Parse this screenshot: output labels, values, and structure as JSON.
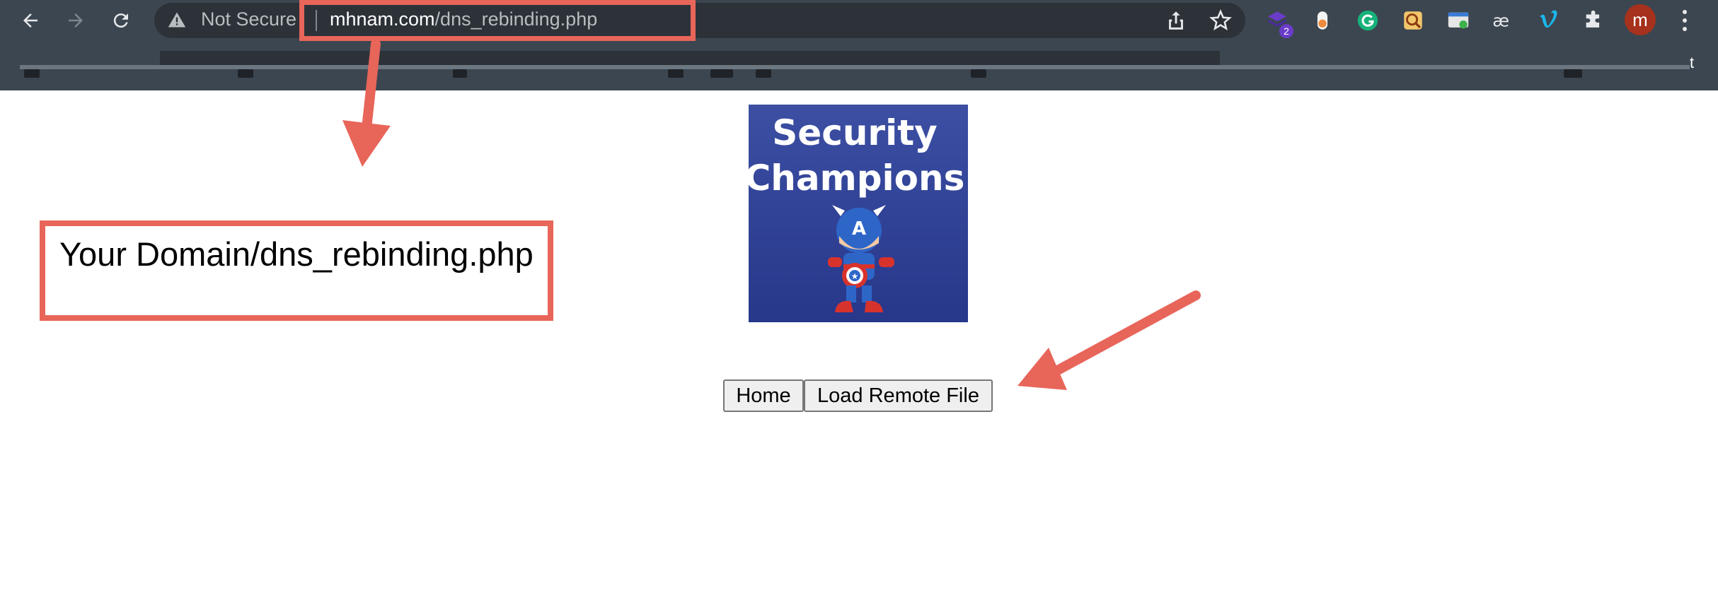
{
  "browser": {
    "address_bar": {
      "security_label": "Not Secure",
      "url_host": "mhnam.com",
      "url_path": "/dns_rebinding.php"
    },
    "extensions": [
      {
        "name": "stack-extension-icon",
        "badge": "2"
      },
      {
        "name": "toggle-extension-icon"
      },
      {
        "name": "grammarly-extension-icon"
      },
      {
        "name": "search-extension-icon"
      },
      {
        "name": "screenshot-extension-icon"
      },
      {
        "name": "ae-extension-icon"
      },
      {
        "name": "vimeo-extension-icon"
      },
      {
        "name": "puzzle-extensions-icon"
      }
    ],
    "profile_initial": "m",
    "bookmarks_trailing_char": "t"
  },
  "page": {
    "logo": {
      "line1": "Security",
      "line2": "Champions"
    },
    "buttons": {
      "home": "Home",
      "load_remote": "Load Remote File"
    }
  },
  "annotations": {
    "domain_note": "Your Domain/dns_rebinding.php",
    "highlight_color": "#e8655a"
  },
  "colors": {
    "chrome_bg": "#3c4650",
    "omnibox_bg": "#2c3238",
    "logo_bg": "#2e3f93",
    "annotation": "#e8655a"
  }
}
